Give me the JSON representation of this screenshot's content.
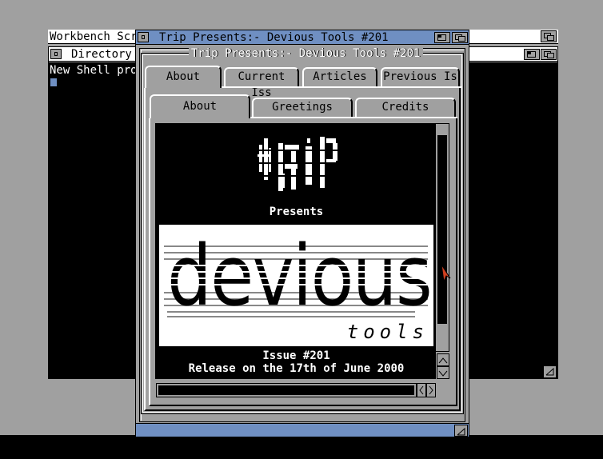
{
  "workbench": {
    "title": "Workbench Scr",
    "directory_title": "Directory",
    "shell_text": "New Shell pro"
  },
  "main_window": {
    "title": "Trip Presents:-  Devious Tools #201",
    "group_title": "Trip Presents:-  Devious Tools #201",
    "top_tabs": [
      "About",
      "Current Iss",
      "Articles",
      "Previous Is"
    ],
    "sub_tabs": [
      "About",
      "Greetings",
      "Credits"
    ]
  },
  "content": {
    "presents": "Presents",
    "logo_main": "devious",
    "logo_sub": "tools",
    "issue": "Issue #201",
    "release": "Release on the 17th of June 2000"
  },
  "colors": {
    "background": "#a0a0a0",
    "titlebar": "#6f8fc2",
    "white": "#ffffff",
    "black": "#000000",
    "cursor": "#d04020"
  }
}
